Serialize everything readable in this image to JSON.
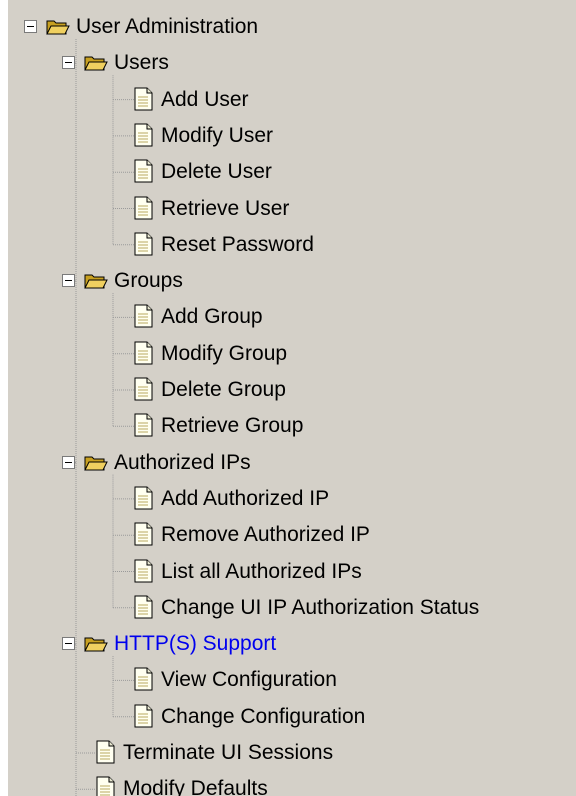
{
  "tree": {
    "root": {
      "label": "User Administration",
      "expanded": true,
      "icon": "folder-open-icon"
    },
    "groups": [
      {
        "label": "Users",
        "expanded": true,
        "icon": "folder-open-icon",
        "items": [
          "Add User",
          "Modify User",
          "Delete User",
          "Retrieve User",
          "Reset Password"
        ]
      },
      {
        "label": "Groups",
        "expanded": true,
        "icon": "folder-open-icon",
        "items": [
          "Add Group",
          "Modify Group",
          "Delete Group",
          "Retrieve Group"
        ]
      },
      {
        "label": "Authorized IPs",
        "expanded": true,
        "icon": "folder-open-icon",
        "items": [
          "Add Authorized IP",
          "Remove Authorized IP",
          "List all Authorized IPs",
          "Change UI IP Authorization Status"
        ]
      },
      {
        "label": "HTTP(S) Support",
        "expanded": true,
        "icon": "folder-open-icon",
        "highlighted": true,
        "items": [
          "View Configuration",
          "Change Configuration"
        ]
      }
    ],
    "leaves": [
      "Terminate UI Sessions",
      "Modify Defaults"
    ]
  },
  "colors": {
    "panel_bg": "#d4d0c8",
    "link_color": "#0000ee",
    "folder_fill": "#f0d060",
    "tree_line": "#9a9a9a"
  }
}
